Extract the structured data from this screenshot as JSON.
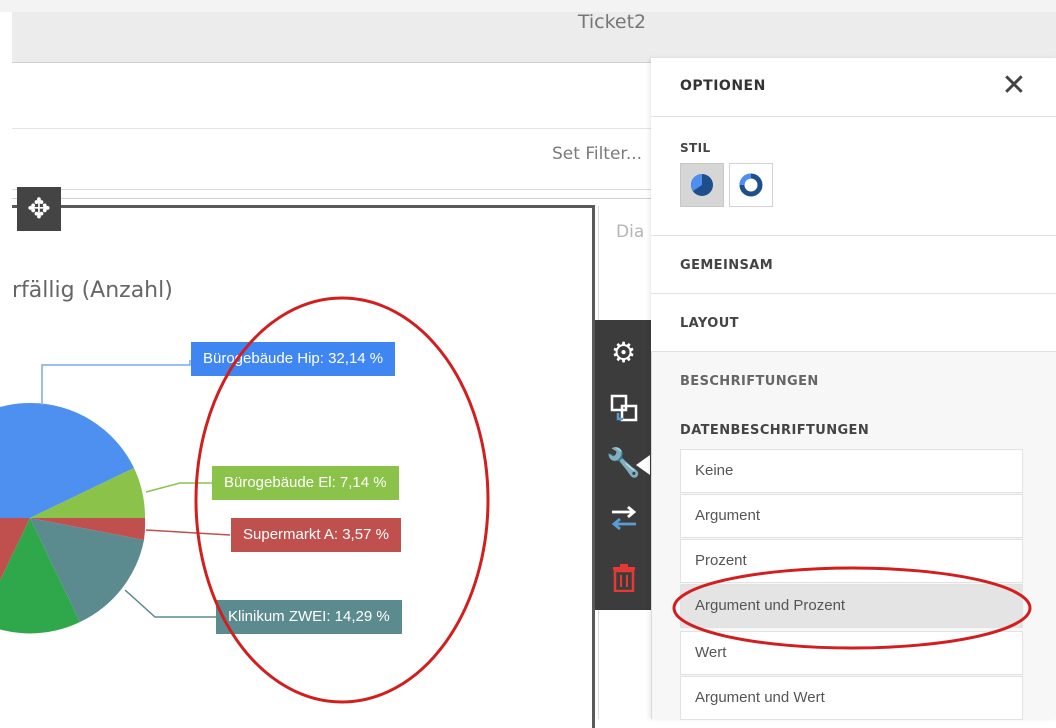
{
  "window": {
    "title": "Ticket2"
  },
  "filter": {
    "set_filter_label": "Set Filter..."
  },
  "chart": {
    "title": "rfällig (Anzahl)",
    "side_text": "Dia"
  },
  "chart_data": {
    "type": "pie",
    "title": "rfällig (Anzahl)",
    "slices": [
      {
        "name": "Bürogebäude Hip",
        "percent": 32.14,
        "color": "#4d90f0"
      },
      {
        "name": "Bürogebäude El",
        "percent": 7.14,
        "color": "#8bc34a"
      },
      {
        "name": "Supermarkt A",
        "percent": 3.57,
        "color": "#c0504d"
      },
      {
        "name": "Klinikum ZWEI",
        "percent": 14.29,
        "color": "#5b8a8f"
      }
    ],
    "data_labels": [
      "Bürogebäude Hip: 32,14 %",
      "Bürogebäude El: 7,14 %",
      "Supermarkt A: 3,57 %",
      "Klinikum ZWEI: 14,29 %"
    ]
  },
  "options": {
    "title": "OPTIONEN",
    "stil_label": "STIL",
    "sections": [
      "GEMEINSAM",
      "LAYOUT",
      "BESCHRIFTUNGEN"
    ],
    "data_labels_heading": "DATENBESCHRIFTUNGEN",
    "data_label_options": [
      "Keine",
      "Argument",
      "Prozent",
      "Argument und Prozent",
      "Wert",
      "Argument und Wert"
    ],
    "selected_option": "Argument und Prozent"
  },
  "colors": {
    "accent_blue": "#3b82f6",
    "annotation_red": "#d11f1f",
    "icon_bar": "#3c3c3c"
  }
}
